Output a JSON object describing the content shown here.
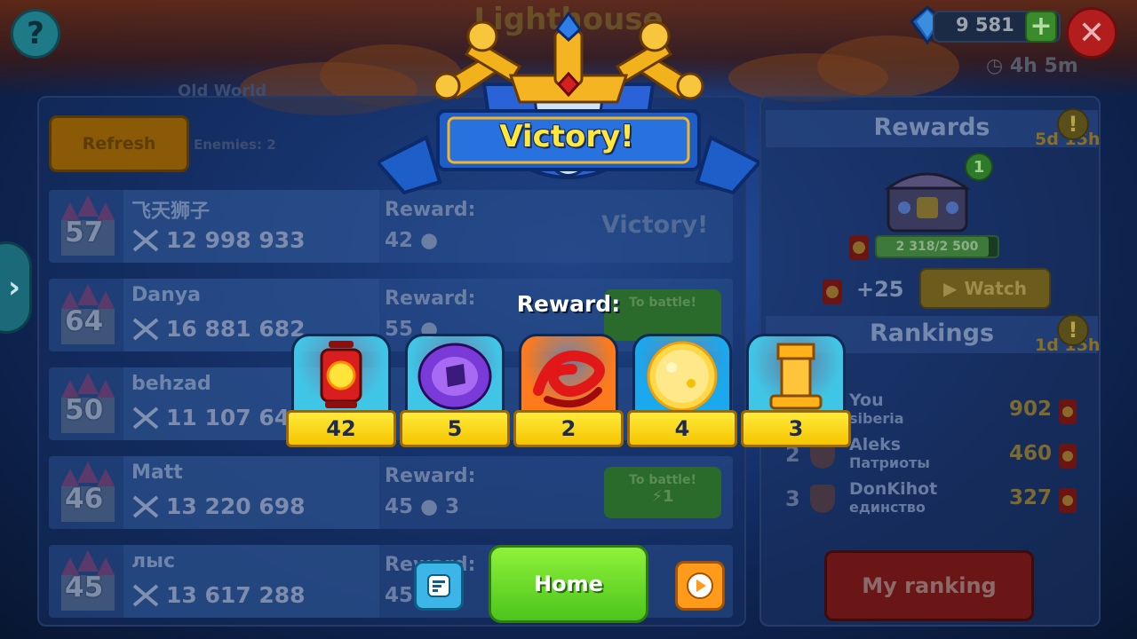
{
  "header": {
    "title": "Lighthouse",
    "gems": "9 581",
    "gems_plus": "+",
    "timer": "4h 5m",
    "help_glyph": "?",
    "close_glyph": "✕",
    "nav_glyph": "›"
  },
  "list_panel": {
    "subtitle": "Old World",
    "refresh_label": "Refresh",
    "enemies_text": "Enemies: 2",
    "rows": [
      {
        "level": "57",
        "name": "飞天狮子",
        "power": "12 998 933",
        "reward_label": "Reward:",
        "reward_value": "42",
        "status": "Victory!",
        "battle_label": "",
        "battle_cost": ""
      },
      {
        "level": "64",
        "name": "Danya",
        "power": "16 881 682",
        "reward_label": "Reward:",
        "reward_value": "55",
        "status": "",
        "battle_label": "To battle!",
        "battle_cost": ""
      },
      {
        "level": "50",
        "name": "behzad",
        "power": "11 107 640",
        "reward_label": "",
        "reward_value": "",
        "status": "",
        "battle_label": "",
        "battle_cost": ""
      },
      {
        "level": "46",
        "name": "Matt",
        "power": "13 220 698",
        "reward_label": "Reward:",
        "reward_value": "45",
        "reward_extra": "3",
        "status": "",
        "battle_label": "To battle!",
        "battle_cost": "1"
      },
      {
        "level": "45",
        "name": "лыс",
        "power": "13 617 288",
        "reward_label": "Reward:",
        "reward_value": "45",
        "status": "",
        "battle_label": "",
        "battle_cost": ""
      }
    ]
  },
  "right_panel": {
    "rewards_title": "Rewards",
    "rewards_time": "5d 15h",
    "chest_badge": "1",
    "progress_text": "2 318/2 500",
    "progress_fraction": 0.927,
    "plus_amount": "+25",
    "watch_label": "Watch",
    "rankings_title": "Rankings",
    "rankings_time": "1d 15h",
    "rankings": [
      {
        "pos": "",
        "name": "You",
        "clan": "siberia",
        "score": "902"
      },
      {
        "pos": "2",
        "name": "Aleks",
        "clan": "Патриоты",
        "score": "460"
      },
      {
        "pos": "3",
        "name": "DonKihot",
        "clan": "единство",
        "score": "327"
      }
    ],
    "my_ranking_label": "My ranking",
    "info_glyph": "!"
  },
  "modal": {
    "banner_text": "Victory!",
    "reward_label": "Reward:",
    "rewards": [
      {
        "icon": "lantern-icon",
        "count": "42",
        "tile_color": "#3fc6e6"
      },
      {
        "icon": "void-crystal-icon",
        "count": "5",
        "tile_color": "#3fc6e6"
      },
      {
        "icon": "red-swirl-icon",
        "count": "2",
        "tile_color": "#ff7a1a"
      },
      {
        "icon": "golden-orb-icon",
        "count": "4",
        "tile_color": "#1aa8ee"
      },
      {
        "icon": "golden-tower-icon",
        "count": "3",
        "tile_color": "#3fc6e6"
      }
    ],
    "home_label": "Home"
  },
  "colors": {
    "accent_yellow": "#ffe838",
    "home_green": "#4cc41c",
    "replay_orange": "#ff9a1a",
    "menu_blue": "#3cb6e8"
  }
}
